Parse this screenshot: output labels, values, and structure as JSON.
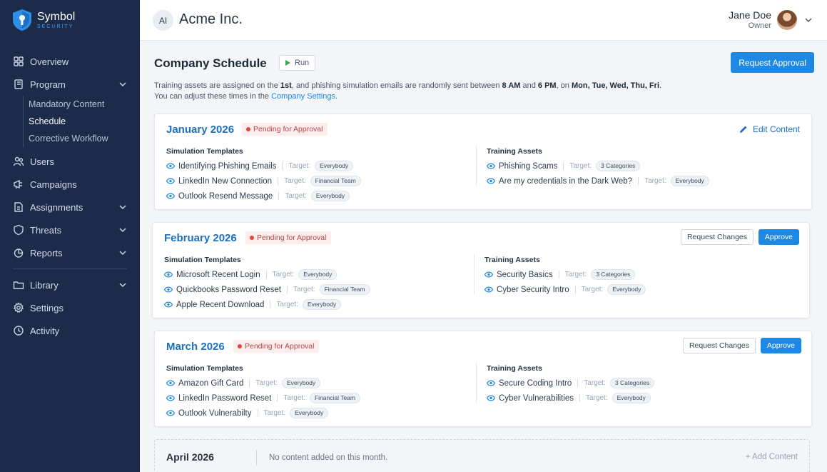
{
  "sidebar": {
    "logo": {
      "name": "Symbol",
      "sub": "SECURITY"
    },
    "items": [
      {
        "label": "Overview",
        "icon": "grid-icon"
      },
      {
        "label": "Program",
        "icon": "book-icon"
      },
      {
        "label": "Users",
        "icon": "users-icon"
      },
      {
        "label": "Campaigns",
        "icon": "megaphone-icon"
      },
      {
        "label": "Assignments",
        "icon": "document-icon"
      },
      {
        "label": "Threats",
        "icon": "shield-icon"
      },
      {
        "label": "Reports",
        "icon": "pie-chart-icon"
      },
      {
        "label": "Library",
        "icon": "folder-icon"
      },
      {
        "label": "Settings",
        "icon": "gear-icon"
      },
      {
        "label": "Activity",
        "icon": "clock-icon"
      }
    ],
    "program_sub": [
      "Mandatory Content",
      "Schedule",
      "Corrective Workflow"
    ],
    "active_sub": "Schedule"
  },
  "topbar": {
    "org_initials": "AI",
    "org_name": "Acme Inc.",
    "user_name": "Jane Doe",
    "user_role": "Owner"
  },
  "page": {
    "title": "Company Schedule",
    "run_label": "Run",
    "request_approval_label": "Request Approval",
    "desc": {
      "p1": "Training assets are assigned on the ",
      "day": "1st",
      "p2": ", and phishing simulation emails are randomly sent between ",
      "start": "8 AM",
      "p3": " and ",
      "end": "6 PM",
      "p4": ", on ",
      "days": "Mon, Tue, Wed, Thu, Fri",
      "p5": ".",
      "line2": "You can adjust these times in the ",
      "link": "Company Settings",
      "line2_end": "."
    }
  },
  "labels": {
    "pending": "Pending for Approval",
    "edit_content": "Edit Content",
    "request_changes": "Request Changes",
    "approve": "Approve",
    "sim_head": "Simulation Templates",
    "train_head": "Training Assets",
    "target": "Target:"
  },
  "months": [
    {
      "name": "January 2026",
      "sims": [
        {
          "name": "Identifying Phishing Emails",
          "target": "Everybody"
        },
        {
          "name": "LinkedIn New Connection",
          "target": "Financial Team"
        },
        {
          "name": "Outlook Resend Message",
          "target": "Everybody"
        }
      ],
      "training": [
        {
          "name": "Phishing Scams",
          "target": "3 Categories"
        },
        {
          "name": "Are my credentials in the Dark Web?",
          "target": "Everybody"
        }
      ]
    },
    {
      "name": "February 2026",
      "sims": [
        {
          "name": "Microsoft Recent Login",
          "target": "Everybody"
        },
        {
          "name": "Quickbooks Password Reset",
          "target": "Financial Team"
        },
        {
          "name": "Apple Recent Download",
          "target": "Everybody"
        }
      ],
      "training": [
        {
          "name": "Security Basics",
          "target": "3 Categories"
        },
        {
          "name": "Cyber Security Intro",
          "target": "Everybody"
        }
      ]
    },
    {
      "name": "March 2026",
      "sims": [
        {
          "name": "Amazon Gift Card",
          "target": "Everybody"
        },
        {
          "name": "LinkedIn Password Reset",
          "target": "Financial Team"
        },
        {
          "name": "Outlook Vulnerabilty",
          "target": "Everybody"
        }
      ],
      "training": [
        {
          "name": "Secure Coding Intro",
          "target": "3 Categories"
        },
        {
          "name": "Cyber Vulnerabilities",
          "target": "Everybody"
        }
      ]
    }
  ],
  "april": {
    "name": "April 2026",
    "empty_text": "No content added on this month.",
    "add_label": "+ Add Content"
  },
  "colors": {
    "accent": "#1e88e5",
    "sidebar": "#1c2b4a",
    "pending": "#e0463f"
  }
}
